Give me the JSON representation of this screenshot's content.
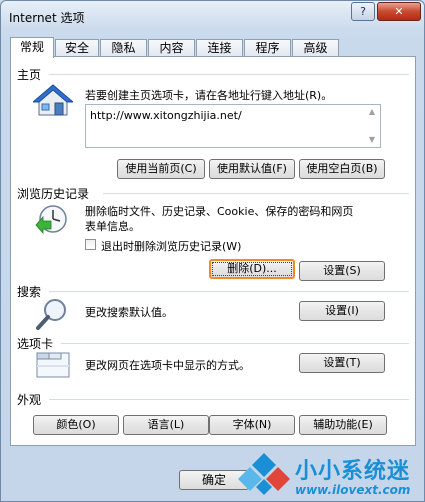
{
  "window": {
    "title": "Internet 选项",
    "help": "?",
    "close": "✕"
  },
  "tabs": [
    "常规",
    "安全",
    "隐私",
    "内容",
    "连接",
    "程序",
    "高级"
  ],
  "home": {
    "label": "主页",
    "desc": "若要创建主页选项卡，请在各地址行键入地址(R)。",
    "url": "http://www.xitongzhijia.net/",
    "btn_current": "使用当前页(C)",
    "btn_default": "使用默认值(F)",
    "btn_blank": "使用空白页(B)"
  },
  "history": {
    "label": "浏览历史记录",
    "desc_line1": "删除临时文件、历史记录、Cookie、保存的密码和网页",
    "desc_line2": "表单信息。",
    "checkbox": "退出时删除浏览历史记录(W)",
    "btn_delete": "删除(D)...",
    "btn_settings": "设置(S)"
  },
  "search": {
    "label": "搜索",
    "desc": "更改搜索默认值。",
    "btn_settings": "设置(I)"
  },
  "tabsgroup": {
    "label": "选项卡",
    "desc": "更改网页在选项卡中显示的方式。",
    "btn_settings": "设置(T)"
  },
  "appearance": {
    "label": "外观",
    "btn_colors": "颜色(O)",
    "btn_languages": "语言(L)",
    "btn_fonts": "字体(N)",
    "btn_accessibility": "辅助功能(E)"
  },
  "footer": {
    "ok": "确定"
  },
  "watermark": {
    "brand": "小小系统迷",
    "url": "www.ilovext.com"
  },
  "colors": {
    "focus_orange": "#f08a24",
    "brand_blue": "#1b8fd6"
  }
}
